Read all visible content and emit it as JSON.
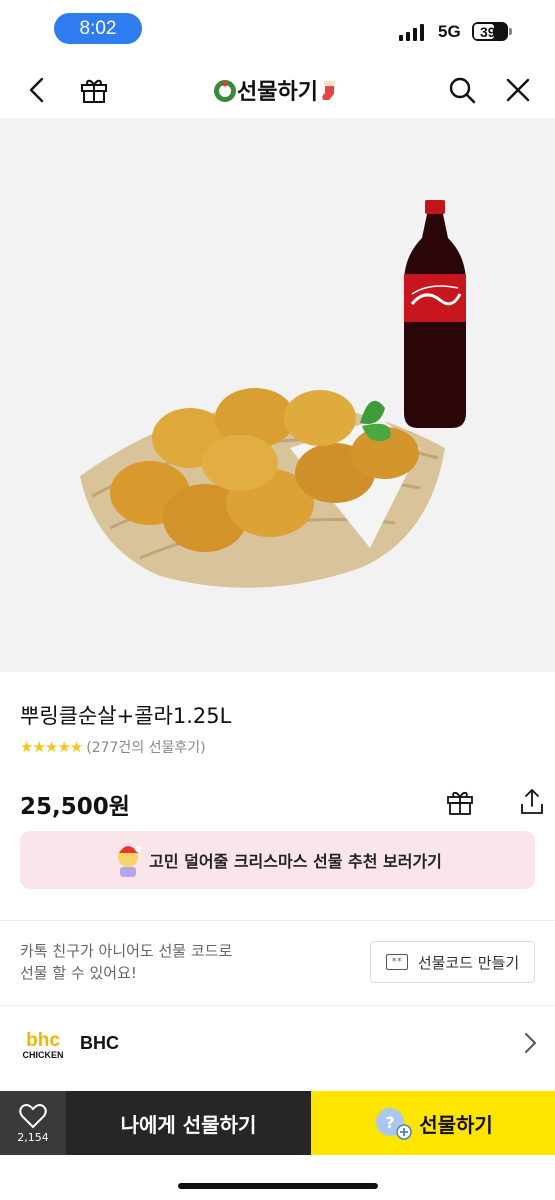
{
  "status": {
    "time": "8:02",
    "network": "5G",
    "battery": "39"
  },
  "nav": {
    "title": "선물하기"
  },
  "product": {
    "name": "뿌링클순살+콜라1.25L",
    "rating": 4.5,
    "review_text": "(277건의 선물후기)",
    "price": "25,500원"
  },
  "banner": {
    "text": "고민 덜어줄 크리스마스 선물 추천 보러가기"
  },
  "gift_code": {
    "line1": "카톡 친구가 아니어도 선물 코드로",
    "line2": "선물 할 수 있어요!",
    "button_label": "선물코드 만들기"
  },
  "brand": {
    "logo_top": "bhc",
    "logo_bottom": "CHICKEN",
    "name": "BHC"
  },
  "bottom_bar": {
    "like_count": "2,154",
    "self_gift_label": "나에게 선물하기",
    "gift_label": "선물하기"
  },
  "colors": {
    "accent": "#fee500",
    "dark": "#262626",
    "banner_bg": "#fae6ea",
    "status_pill": "#2f7cf0"
  },
  "icons": [
    "back-icon",
    "gift-icon",
    "search-icon",
    "close-icon",
    "share-icon",
    "heart-icon",
    "chevron-right-icon"
  ]
}
